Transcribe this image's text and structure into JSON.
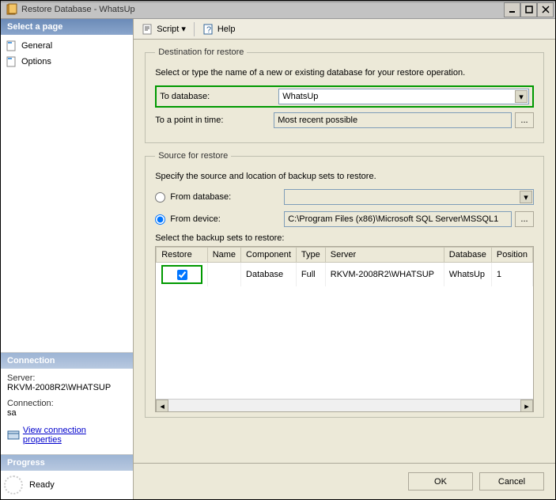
{
  "window": {
    "title": "Restore Database - WhatsUp"
  },
  "titlebar_buttons": {
    "min": "_",
    "max": "◻",
    "close": "✕"
  },
  "sidebar": {
    "select_page_label": "Select a page",
    "pages": {
      "general": "General",
      "options": "Options"
    },
    "connection": {
      "header": "Connection",
      "server_label": "Server:",
      "server_value": "RKVM-2008R2\\WHATSUP",
      "conn_label": "Connection:",
      "conn_value": "sa",
      "view_props": "View connection properties"
    },
    "progress": {
      "header": "Progress",
      "status": "Ready"
    }
  },
  "toolbar": {
    "script": "Script",
    "help": "Help"
  },
  "dest": {
    "legend": "Destination for restore",
    "note": "Select or type the name of a new or existing database for your restore operation.",
    "to_db_label": "To database:",
    "to_db_value": "WhatsUp",
    "point_label": "To a point in time:",
    "point_value": "Most recent possible"
  },
  "source": {
    "legend": "Source for restore",
    "note": "Specify the source and location of backup sets to restore.",
    "from_db_label": "From database:",
    "from_db_value": "",
    "from_device_label": "From device:",
    "from_device_value": "C:\\Program Files (x86)\\Microsoft SQL Server\\MSSQL1",
    "select_sets_label": "Select the backup sets to restore:",
    "columns": {
      "restore": "Restore",
      "name": "Name",
      "component": "Component",
      "type": "Type",
      "server": "Server",
      "database": "Database",
      "position": "Position"
    },
    "rows": [
      {
        "restore": true,
        "name": "",
        "component": "Database",
        "type": "Full",
        "server": "RKVM-2008R2\\WHATSUP",
        "database": "WhatsUp",
        "position": "1"
      }
    ]
  },
  "footer": {
    "ok": "OK",
    "cancel": "Cancel"
  },
  "ellipsis": "..."
}
